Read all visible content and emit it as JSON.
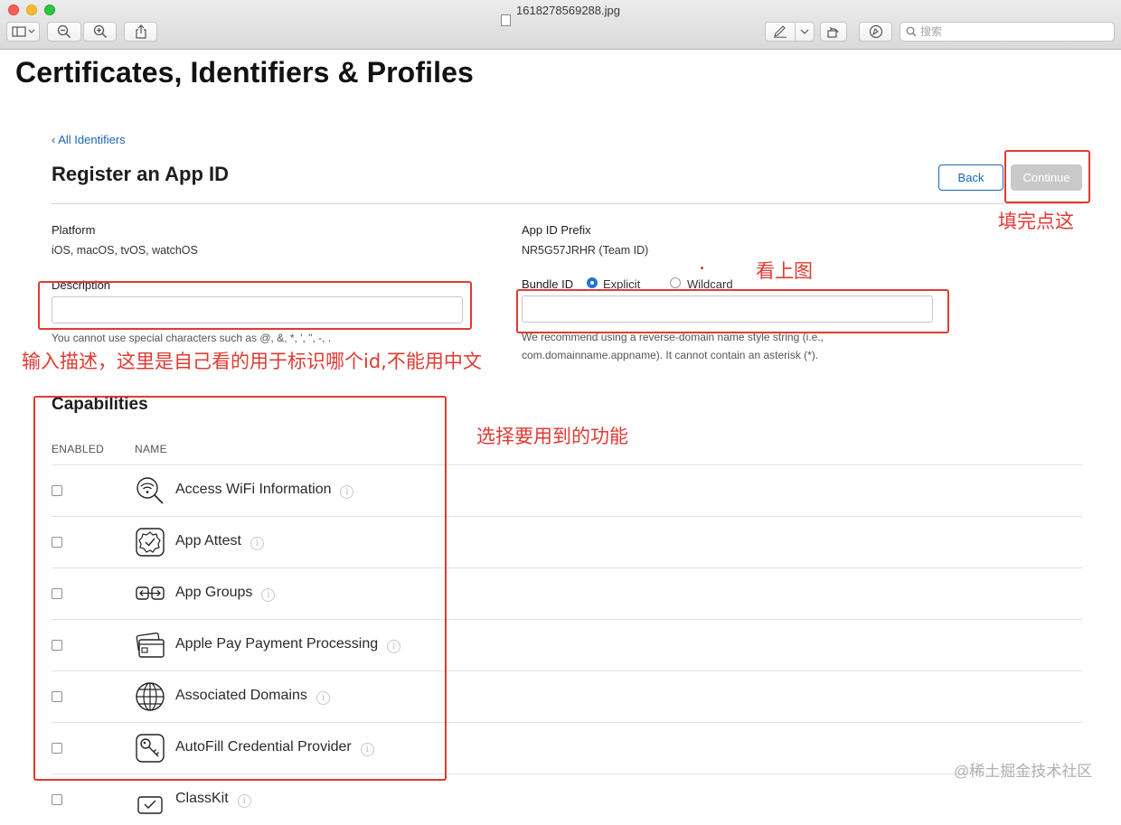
{
  "window": {
    "title": "1618278569288.jpg",
    "search_placeholder": "搜索"
  },
  "page": {
    "title": "Certificates, Identifiers & Profiles",
    "back_link": "‹ All Identifiers",
    "heading": "Register an App ID",
    "back_button": "Back",
    "continue_button": "Continue"
  },
  "form": {
    "platform_label": "Platform",
    "platform_value": "iOS, macOS, tvOS, watchOS",
    "prefix_label": "App ID Prefix",
    "prefix_value": "NR5G57JRHR (Team ID)",
    "description_label": "Description",
    "description_value": "",
    "description_hint": "You cannot use special characters such as @, &, *, ', \", -, .",
    "bundle_label": "Bundle ID",
    "bundle_explicit": "Explicit",
    "bundle_wildcard": "Wildcard",
    "bundle_value": "",
    "bundle_hint_1": "We recommend using a reverse-domain name style string (i.e.,",
    "bundle_hint_2": "com.domainname.appname). It cannot contain an asterisk (*)."
  },
  "capabilities": {
    "title": "Capabilities",
    "col_enabled": "ENABLED",
    "col_name": "NAME",
    "items": [
      {
        "name": "Access WiFi Information",
        "icon": "wifi-search-icon",
        "enabled": false
      },
      {
        "name": "App Attest",
        "icon": "attest-badge-icon",
        "enabled": false
      },
      {
        "name": "App Groups",
        "icon": "app-groups-icon",
        "enabled": false
      },
      {
        "name": "Apple Pay Payment Processing",
        "icon": "apple-pay-card-icon",
        "enabled": false
      },
      {
        "name": "Associated Domains",
        "icon": "globe-icon",
        "enabled": false
      },
      {
        "name": "AutoFill Credential Provider",
        "icon": "key-icon",
        "enabled": false
      },
      {
        "name": "ClassKit",
        "icon": "classkit-icon",
        "enabled": false
      }
    ]
  },
  "annotations": {
    "continue_note": "填完点这",
    "bundle_note": "看上图",
    "description_note": "输入描述，这里是自己看的用于标识哪个id,不能用中文",
    "capabilities_note": "选择要用到的功能",
    "color": "#e03a32"
  },
  "watermark": "@稀土掘金技术社区"
}
